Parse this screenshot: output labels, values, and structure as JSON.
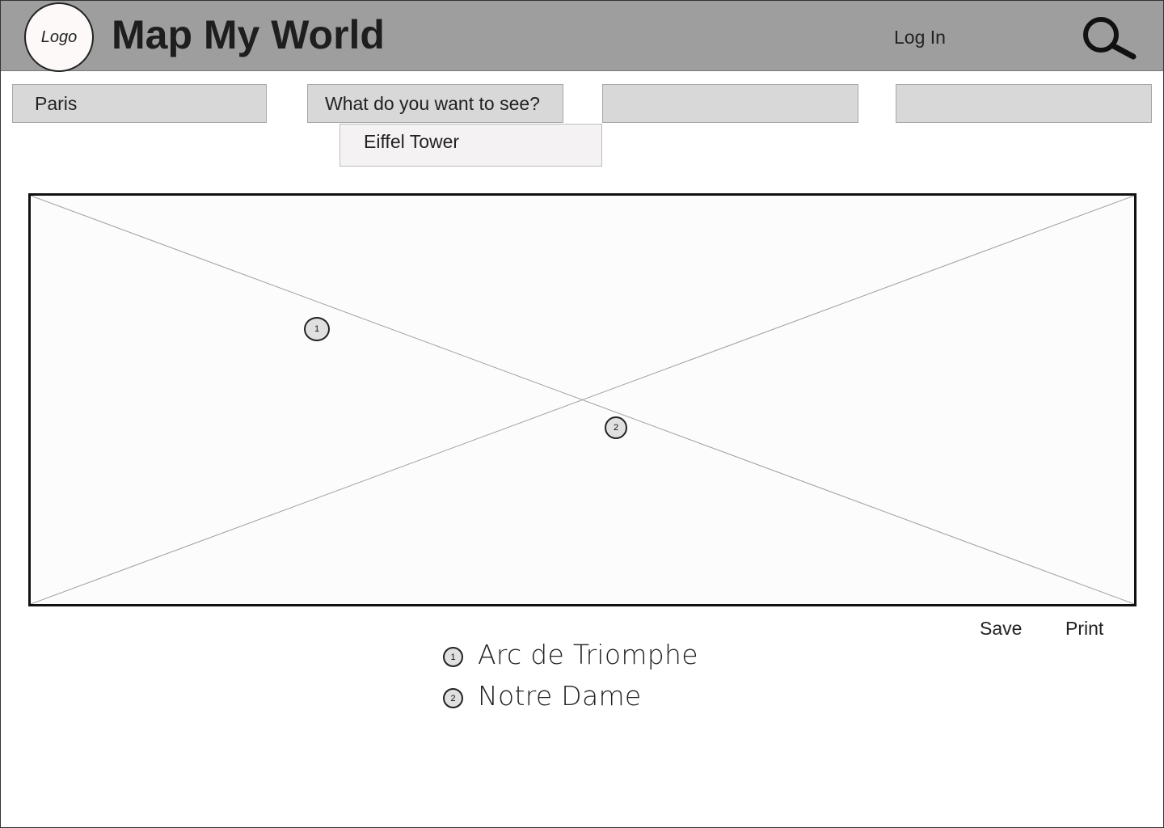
{
  "header": {
    "logo_label": "Logo",
    "title": "Map My World",
    "login_label": "Log In",
    "search_icon": "search-icon"
  },
  "filters": {
    "city_value": "Paris",
    "attraction_placeholder": "What do you want to see?",
    "field3_value": "",
    "field4_value": ""
  },
  "dropdown": {
    "items": [
      "Eiffel Tower"
    ]
  },
  "map": {
    "placeholder": "image-placeholder",
    "markers": [
      {
        "number": "1"
      },
      {
        "number": "2"
      }
    ]
  },
  "actions": {
    "save_label": "Save",
    "print_label": "Print"
  },
  "legend": {
    "items": [
      {
        "number": "1",
        "label": "Arc de Triomphe"
      },
      {
        "number": "2",
        "label": "Notre Dame"
      }
    ]
  },
  "colors": {
    "header_bg": "#9e9e9e",
    "field_bg": "#d8d8d8",
    "dropdown_bg": "#f4f2f2"
  }
}
